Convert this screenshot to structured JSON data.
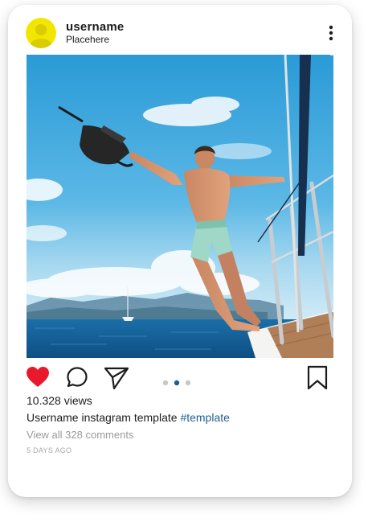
{
  "post": {
    "username": "username",
    "location": "Placehere",
    "views": "10.328 views",
    "caption": {
      "author": "Username",
      "text": "instagram template",
      "hashtag": "#template"
    },
    "view_comments": "View all 328 comments",
    "timestamp": "5 DAYS AGO"
  },
  "carousel": {
    "count": 3,
    "active_index": 1
  },
  "icons": {
    "more": "more-vertical-icon",
    "like": "heart-icon",
    "comment": "comment-icon",
    "share": "send-icon",
    "save": "bookmark-icon"
  },
  "colors": {
    "avatar": "#f2e600",
    "like": "#e8192c",
    "hashtag": "#1f5f8f",
    "active_dot": "#1f5f8f",
    "inactive_dot": "#c8c8c8"
  }
}
